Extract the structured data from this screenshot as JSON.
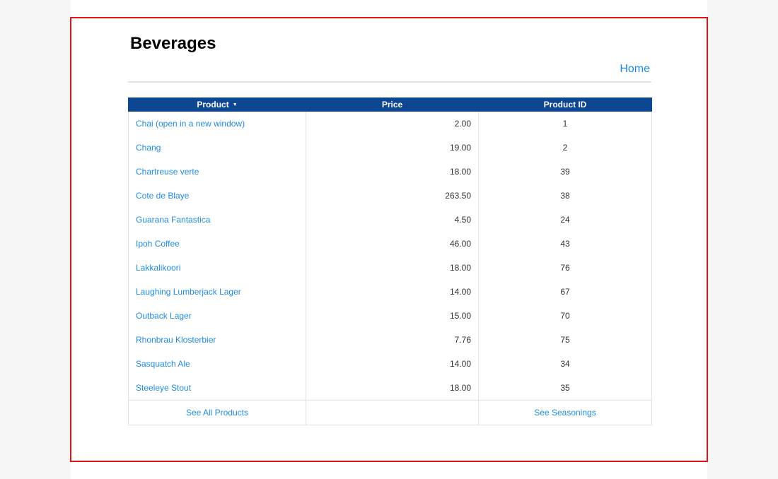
{
  "page": {
    "title": "Beverages",
    "home_link": "Home"
  },
  "table": {
    "columns": [
      "Product",
      "Price",
      "Product ID"
    ],
    "rows": [
      {
        "name": "Chai  (open in a new window)",
        "price": "2.00",
        "id": "1"
      },
      {
        "name": "Chang",
        "price": "19.00",
        "id": "2"
      },
      {
        "name": "Chartreuse verte",
        "price": "18.00",
        "id": "39"
      },
      {
        "name": "Cote de Blaye",
        "price": "263.50",
        "id": "38"
      },
      {
        "name": "Guarana Fantastica",
        "price": "4.50",
        "id": "24"
      },
      {
        "name": "Ipoh Coffee",
        "price": "46.00",
        "id": "43"
      },
      {
        "name": "Lakkalikoori",
        "price": "18.00",
        "id": "76"
      },
      {
        "name": "Laughing Lumberjack Lager",
        "price": "14.00",
        "id": "67"
      },
      {
        "name": "Outback Lager",
        "price": "15.00",
        "id": "70"
      },
      {
        "name": "Rhonbrau Klosterbier",
        "price": "7.76",
        "id": "75"
      },
      {
        "name": "Sasquatch Ale",
        "price": "14.00",
        "id": "34"
      },
      {
        "name": "Steeleye Stout",
        "price": "18.00",
        "id": "35"
      }
    ],
    "footer": {
      "see_all": "See All Products",
      "see_seasonings": "See Seasonings"
    }
  },
  "icons": {
    "sort": "sort-descending-caret-icon"
  },
  "colors": {
    "header_bg": "#0d4791",
    "link": "#1f8ce6",
    "frame_border": "#e0151a"
  }
}
